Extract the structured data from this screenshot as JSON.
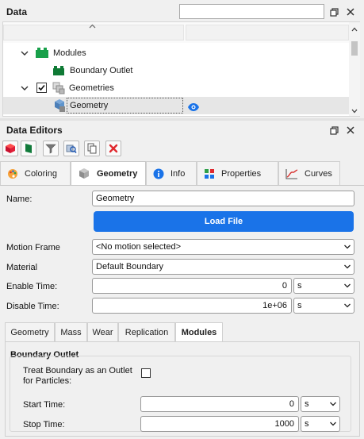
{
  "data_panel": {
    "title": "Data",
    "search_placeholder": "",
    "tree": {
      "modules_label": "Modules",
      "boundary_outlet_label": "Boundary Outlet",
      "geometries_label": "Geometries",
      "geometry_label": "Geometry"
    }
  },
  "editors_panel": {
    "title": "Data Editors",
    "tabs": [
      {
        "label": "Coloring"
      },
      {
        "label": "Geometry"
      },
      {
        "label": "Info"
      },
      {
        "label": "Properties"
      },
      {
        "label": "Curves"
      }
    ]
  },
  "geometry_form": {
    "name_label": "Name:",
    "name_value": "Geometry",
    "load_file_label": "Load File",
    "motion_frame_label": "Motion Frame",
    "motion_frame_value": "<No motion selected>",
    "material_label": "Material",
    "material_value": "Default Boundary",
    "enable_time_label": "Enable Time:",
    "enable_time_value": "0",
    "enable_time_unit": "s",
    "disable_time_label": "Disable Time:",
    "disable_time_value": "1e+06",
    "disable_time_unit": "s"
  },
  "sub_tabs": [
    {
      "label": "Geometry"
    },
    {
      "label": "Mass"
    },
    {
      "label": "Wear"
    },
    {
      "label": "Replication"
    },
    {
      "label": "Modules"
    }
  ],
  "modules_section": {
    "group_title": "Boundary Outlet",
    "treat_label_line1": "Treat Boundary as an Outlet",
    "treat_label_line2": "for Particles:",
    "start_time_label": "Start Time:",
    "start_time_value": "0",
    "start_time_unit": "s",
    "stop_time_label": "Stop Time:",
    "stop_time_value": "1000",
    "stop_time_unit": "s"
  },
  "colors": {
    "accent_blue": "#1a73e8",
    "panel_bg": "#f0f0f0",
    "selected_row": "#e6e6e6"
  }
}
